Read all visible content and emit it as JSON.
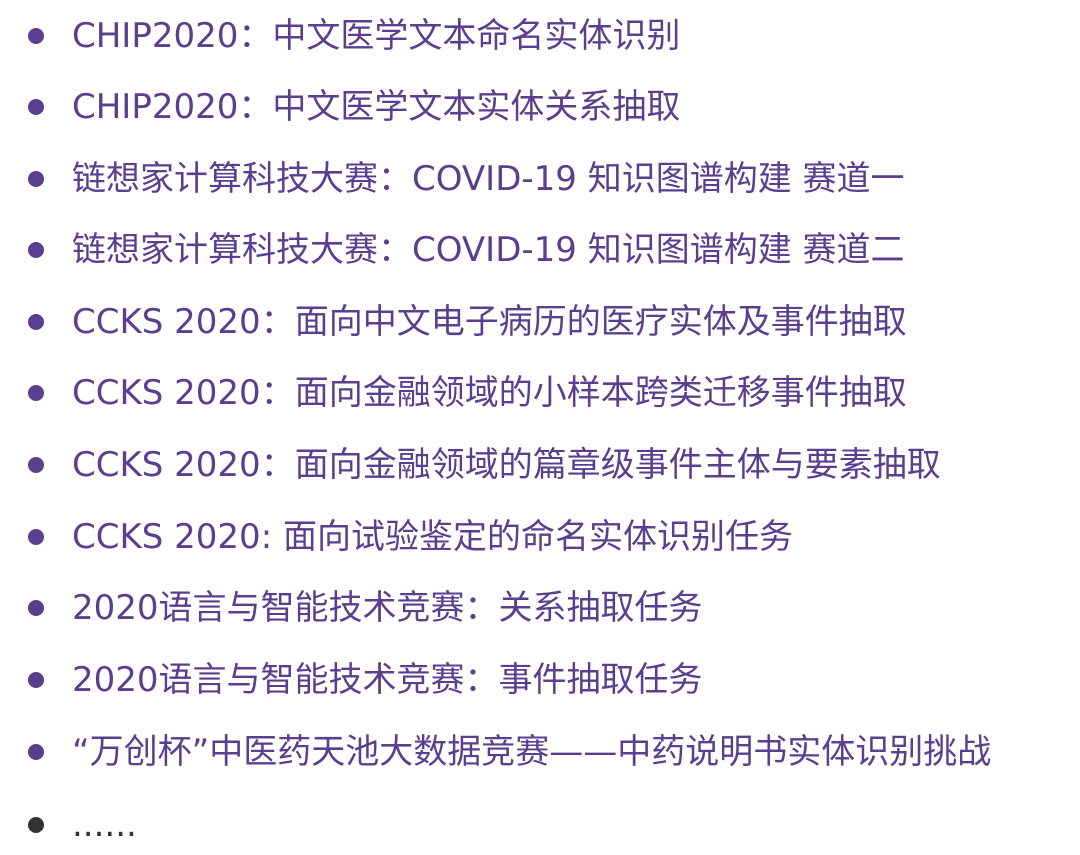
{
  "colors": {
    "accent": "#5b3f8e",
    "plain": "#333333",
    "background": "#ffffff"
  },
  "list": {
    "items": [
      {
        "label": "CHIP2020：中文医学文本命名实体识别"
      },
      {
        "label": "CHIP2020：中文医学文本实体关系抽取"
      },
      {
        "label": "链想家计算科技大赛：COVID-19 知识图谱构建 赛道一"
      },
      {
        "label": "链想家计算科技大赛：COVID-19 知识图谱构建 赛道二"
      },
      {
        "label": "CCKS 2020：面向中文电子病历的医疗实体及事件抽取"
      },
      {
        "label": "CCKS 2020：面向金融领域的小样本跨类迁移事件抽取"
      },
      {
        "label": "CCKS 2020：面向金融领域的篇章级事件主体与要素抽取"
      },
      {
        "label": "CCKS 2020: 面向试验鉴定的命名实体识别任务"
      },
      {
        "label": "2020语言与智能技术竞赛：关系抽取任务"
      },
      {
        "label": "2020语言与智能技术竞赛：事件抽取任务"
      },
      {
        "label": "“万创杯”中医药天池大数据竞赛——中药说明书实体识别挑战"
      },
      {
        "label": "......"
      }
    ]
  }
}
